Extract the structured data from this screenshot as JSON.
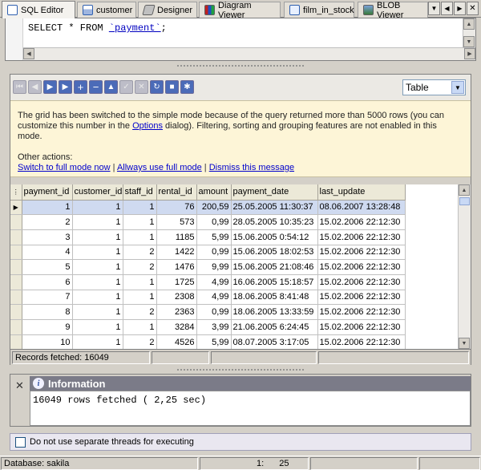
{
  "tabs": [
    {
      "label": "SQL Editor",
      "icon": "sql-editor-icon",
      "active": true
    },
    {
      "label": "customer",
      "icon": "table-icon",
      "active": false
    },
    {
      "label": "Designer",
      "icon": "designer-icon",
      "active": false
    },
    {
      "label": "Diagram Viewer",
      "icon": "diagram-icon",
      "active": false
    },
    {
      "label": "film_in_stock",
      "icon": "procedure-icon",
      "active": false
    },
    {
      "label": "BLOB Viewer",
      "icon": "blob-icon",
      "active": false
    }
  ],
  "editor": {
    "sql_prefix": "SELECT * FROM ",
    "sql_table": "`payment`",
    "sql_suffix": ";"
  },
  "toolbar": {
    "view_mode": "Table"
  },
  "message": {
    "line1": "The grid has been switched to the simple mode because of the query returned more than 5000 rows (you can",
    "line2_prefix": "customize this number in the ",
    "options_link": "Options",
    "line2_suffix": " dialog). Filtering, sorting and grouping features are not enabled in this mode.",
    "other_actions": "Other actions:",
    "action1": "Switch to full mode now",
    "action2": "Allways use full mode",
    "action3": "Dismiss this message",
    "separator": "|"
  },
  "grid": {
    "columns": [
      "payment_id",
      "customer_id",
      "staff_id",
      "rental_id",
      "amount",
      "payment_date",
      "last_update"
    ],
    "rows": [
      [
        "1",
        "1",
        "1",
        "76",
        "200,59",
        "25.05.2005 11:30:37",
        "08.06.2007 13:28:48"
      ],
      [
        "2",
        "1",
        "1",
        "573",
        "0,99",
        "28.05.2005 10:35:23",
        "15.02.2006 22:12:30"
      ],
      [
        "3",
        "1",
        "1",
        "1185",
        "5,99",
        "15.06.2005 0:54:12",
        "15.02.2006 22:12:30"
      ],
      [
        "4",
        "1",
        "2",
        "1422",
        "0,99",
        "15.06.2005 18:02:53",
        "15.02.2006 22:12:30"
      ],
      [
        "5",
        "1",
        "2",
        "1476",
        "9,99",
        "15.06.2005 21:08:46",
        "15.02.2006 22:12:30"
      ],
      [
        "6",
        "1",
        "1",
        "1725",
        "4,99",
        "16.06.2005 15:18:57",
        "15.02.2006 22:12:30"
      ],
      [
        "7",
        "1",
        "1",
        "2308",
        "4,99",
        "18.06.2005 8:41:48",
        "15.02.2006 22:12:30"
      ],
      [
        "8",
        "1",
        "2",
        "2363",
        "0,99",
        "18.06.2005 13:33:59",
        "15.02.2006 22:12:30"
      ],
      [
        "9",
        "1",
        "1",
        "3284",
        "3,99",
        "21.06.2005 6:24:45",
        "15.02.2006 22:12:30"
      ],
      [
        "10",
        "1",
        "2",
        "4526",
        "5,99",
        "08.07.2005 3:17:05",
        "15.02.2006 22:12:30"
      ]
    ],
    "records_fetched": "Records fetched: 16049"
  },
  "info": {
    "title": "Information",
    "text": "16049 rows fetched ( 2,25 sec)"
  },
  "bottom": {
    "checkbox_label": "Do not use separate threads for executing",
    "checked": false
  },
  "statusbar": {
    "database": "Database: sakila",
    "line": "1:",
    "col": "25"
  }
}
